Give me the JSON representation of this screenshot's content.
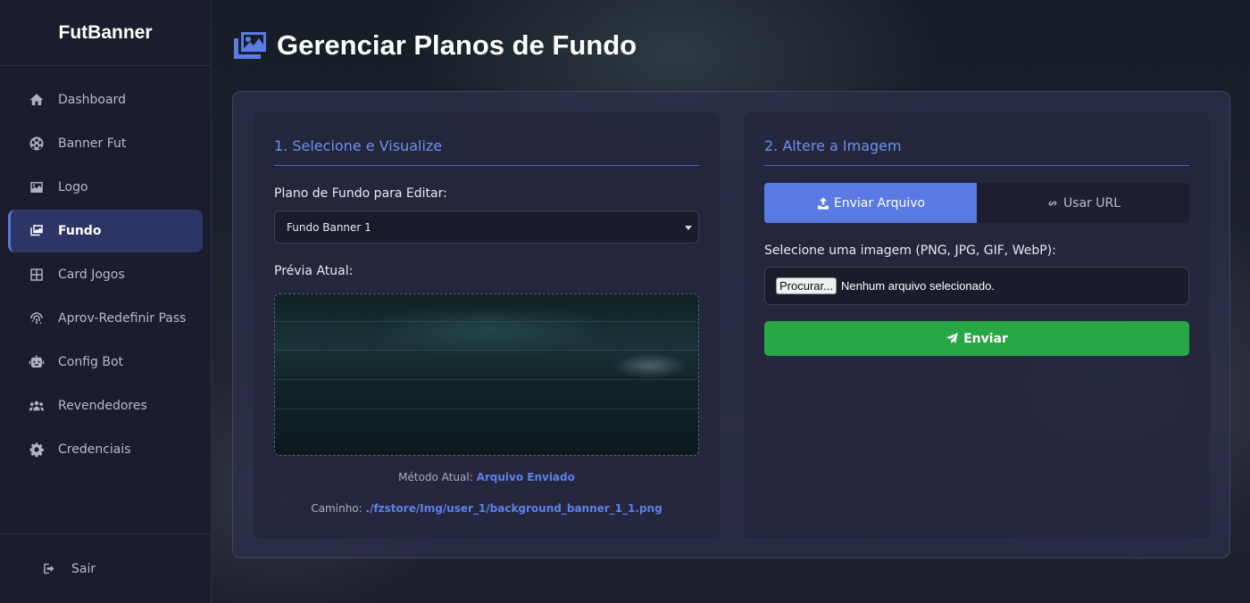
{
  "app": {
    "brand": "FutBanner"
  },
  "sidebar": {
    "items": [
      {
        "label": "Dashboard",
        "icon": "home-icon"
      },
      {
        "label": "Banner Fut",
        "icon": "soccer-ball-icon"
      },
      {
        "label": "Logo",
        "icon": "image-icon"
      },
      {
        "label": "Fundo",
        "icon": "images-icon",
        "active": true
      },
      {
        "label": "Card Jogos",
        "icon": "grid-icon"
      },
      {
        "label": "Aprov-Redefinir Pass",
        "icon": "fingerprint-icon"
      },
      {
        "label": "Config Bot",
        "icon": "robot-icon"
      },
      {
        "label": "Revendedores",
        "icon": "users-icon"
      },
      {
        "label": "Credenciais",
        "icon": "gear-icon"
      }
    ],
    "logout_label": "Sair"
  },
  "page": {
    "title": "Gerenciar Planos de Fundo"
  },
  "left_card": {
    "title": "1. Selecione e Visualize",
    "select_label": "Plano de Fundo para Editar:",
    "select_value": "Fundo Banner 1",
    "preview_label": "Prévia Atual:",
    "method_label": "Método Atual:",
    "method_value": "Arquivo Enviado",
    "path_label": "Caminho:",
    "path_value": "./fzstore/Img/user_1/background_banner_1_1.png"
  },
  "right_card": {
    "title": "2. Altere a Imagem",
    "tab_upload": "Enviar Arquivo",
    "tab_url": "Usar URL",
    "file_label": "Selecione uma imagem (PNG, JPG, GIF, WebP):",
    "browse_label": "Procurar...",
    "no_file_text": "Nenhum arquivo selecionado.",
    "submit_label": "Enviar"
  },
  "colors": {
    "accent": "#5a79e3",
    "submit": "#28a745",
    "sidebar_bg": "#1b1d2e"
  }
}
